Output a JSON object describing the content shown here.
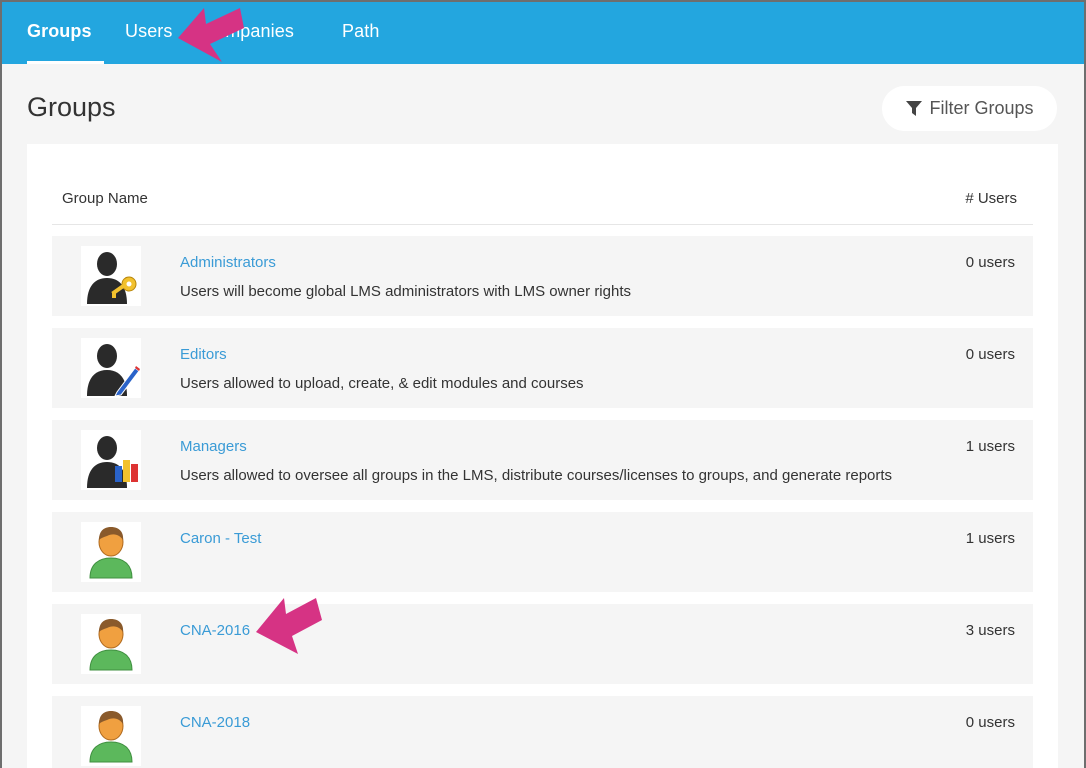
{
  "nav": {
    "tabs": [
      {
        "label": "Groups",
        "active": true
      },
      {
        "label": "Users"
      },
      {
        "label": "Companies"
      },
      {
        "label": "Path"
      }
    ]
  },
  "page": {
    "title": "Groups",
    "filter_label": "Filter Groups"
  },
  "table": {
    "col_name": "Group Name",
    "col_users": "# Users",
    "rows": [
      {
        "name": "Administrators",
        "description": "Users will become global LMS administrators with LMS owner rights",
        "users": "0 users",
        "icon": "admin-key-icon"
      },
      {
        "name": "Editors",
        "description": "Users allowed to upload, create, & edit modules and courses",
        "users": "0 users",
        "icon": "editor-pencil-icon"
      },
      {
        "name": "Managers",
        "description": "Users allowed to oversee all groups in the LMS, distribute courses/licenses to groups, and generate reports",
        "users": "1 users",
        "icon": "manager-chart-icon"
      },
      {
        "name": "Caron - Test",
        "description": "",
        "users": "1 users",
        "icon": "user-icon"
      },
      {
        "name": "CNA-2016",
        "description": "",
        "users": "3 users",
        "icon": "user-icon"
      },
      {
        "name": "CNA-2018",
        "description": "",
        "users": "0 users",
        "icon": "user-icon"
      }
    ]
  },
  "colors": {
    "nav_bg": "#23a6df",
    "link": "#3a9bd6",
    "annotation_arrow": "#d63384"
  }
}
